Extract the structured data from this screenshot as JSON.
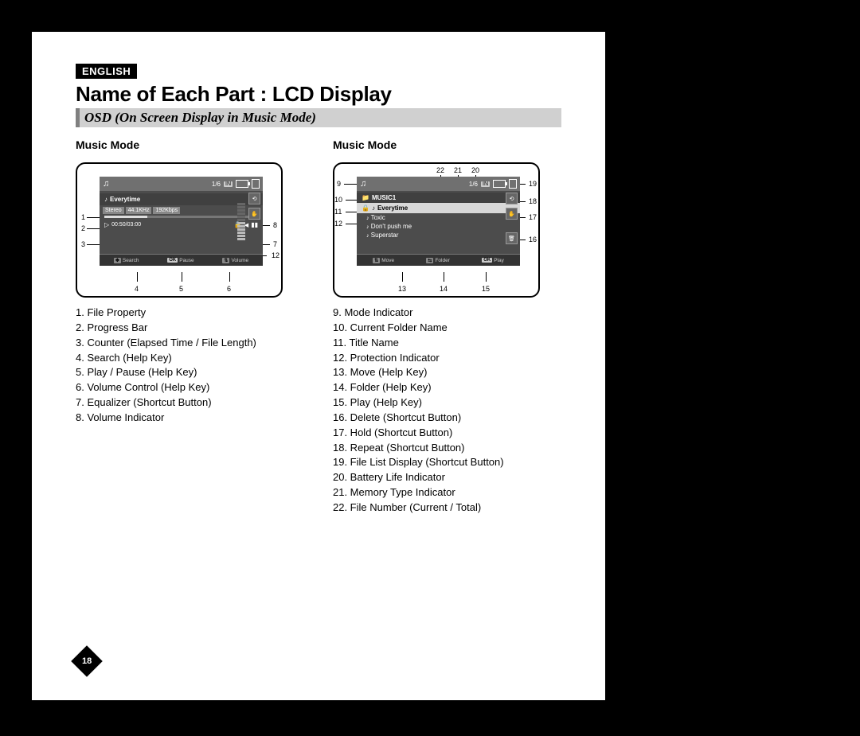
{
  "language_badge": "ENGLISH",
  "title": "Name of Each Part : LCD Display",
  "subtitle": "OSD (On Screen Display in Music Mode)",
  "page_number": "18",
  "columns": {
    "left": {
      "header": "Music Mode",
      "lcd": {
        "file_number": "1/6",
        "mem_type": "IN",
        "track_title": "Everytime",
        "props": {
          "channels": "Stereo",
          "samplerate": "44.1KHz",
          "bitrate": "192Kbps"
        },
        "counter": "00:50/03:00",
        "help": {
          "search": "Search",
          "pause": "Pause",
          "volume": "Volume",
          "ok": "OK"
        },
        "callout_inside": {
          "n4": "4",
          "n5": "5",
          "n6": "6"
        },
        "callout_left": {
          "n1": "1",
          "n2": "2",
          "n3": "3"
        },
        "callout_right": {
          "n7": "7",
          "n8": "8",
          "n12": "12"
        }
      },
      "legend": [
        "1. File Property",
        "2. Progress Bar",
        "3. Counter (Elapsed Time / File Length)",
        "4. Search (Help Key)",
        "5. Play / Pause (Help Key)",
        "6. Volume Control (Help Key)",
        "7. Equalizer (Shortcut Button)",
        "8. Volume Indicator"
      ]
    },
    "right": {
      "header": "Music Mode",
      "lcd": {
        "file_number": "1/6",
        "mem_type": "IN",
        "folder": "MUSIC1",
        "highlight": "Everytime",
        "items": [
          "Toxic",
          "Don't push me",
          "Superstar"
        ],
        "help": {
          "move": "Move",
          "folder_key": "Folder",
          "play": "Play",
          "ok": "OK"
        },
        "callout_top": {
          "n20": "20",
          "n21": "21",
          "n22": "22"
        },
        "callout_left": {
          "n9": "9",
          "n10": "10",
          "n11": "11",
          "n12": "12"
        },
        "callout_right": {
          "n16": "16",
          "n17": "17",
          "n18": "18",
          "n19": "19"
        },
        "callout_bottom": {
          "n13": "13",
          "n14": "14",
          "n15": "15"
        }
      },
      "legend": [
        "9. Mode Indicator",
        "10. Current Folder Name",
        "11. Title Name",
        "12. Protection Indicator",
        "13. Move (Help Key)",
        "14. Folder (Help Key)",
        "15. Play (Help Key)",
        "16. Delete (Shortcut Button)",
        "17. Hold (Shortcut Button)",
        "18. Repeat (Shortcut Button)",
        "19. File List Display (Shortcut Button)",
        "20. Battery Life Indicator",
        "21. Memory Type Indicator",
        "22. File Number (Current / Total)"
      ]
    }
  }
}
